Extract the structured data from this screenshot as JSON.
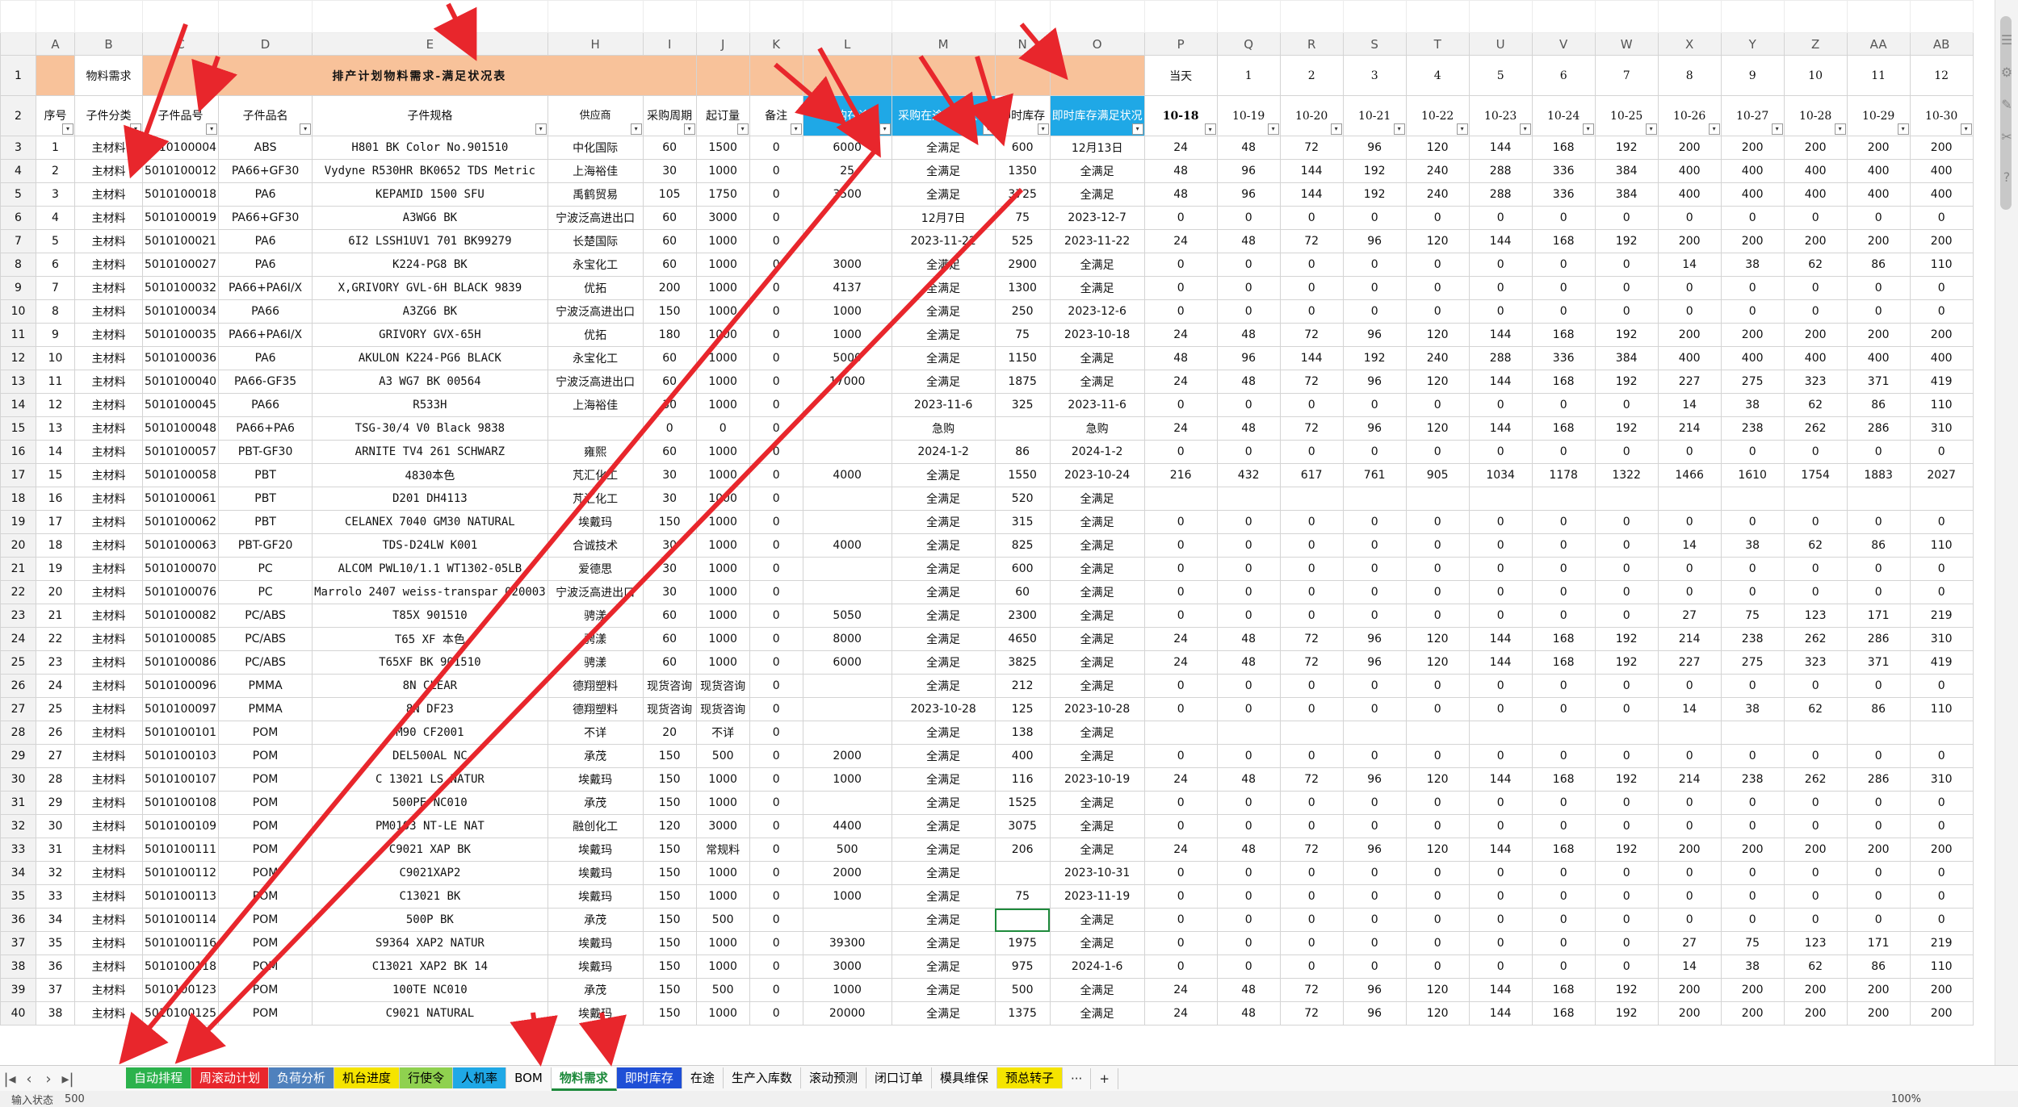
{
  "columns": [
    "A",
    "B",
    "C",
    "D",
    "E",
    "H",
    "I",
    "J",
    "K",
    "L",
    "M",
    "N",
    "O",
    "P",
    "Q",
    "R",
    "S",
    "T",
    "U",
    "V",
    "W",
    "X",
    "Y",
    "Z",
    "AA",
    "AB"
  ],
  "title": "排产计划物料需求-满足状况表",
  "sheet_label": "物料需求",
  "day_labels": [
    "当天",
    "1",
    "2",
    "3",
    "4",
    "5",
    "6",
    "7",
    "8",
    "9",
    "10",
    "11",
    "12"
  ],
  "dates": [
    "10-18",
    "10-19",
    "10-20",
    "10-21",
    "10-22",
    "10-23",
    "10-24",
    "10-25",
    "10-26",
    "10-27",
    "10-28",
    "10-29",
    "10-30"
  ],
  "headers": [
    "序号",
    "子件分类",
    "子件品号",
    "子件品名",
    "子件规格",
    "供应商",
    "采购周期",
    "起订量",
    "备注",
    "采购在途",
    "采购在途满足状况",
    "即时库存",
    "即时库存满足状况"
  ],
  "rows": [
    [
      "1",
      "主材料",
      "5010100004",
      "ABS",
      "H801 BK Color No.901510",
      "中化国际",
      "60",
      "1500",
      "0",
      "6000",
      "全满足",
      "600",
      "12月13日",
      "24",
      "48",
      "72",
      "96",
      "120",
      "144",
      "168",
      "192",
      "200",
      "200",
      "200",
      "200",
      "200"
    ],
    [
      "2",
      "主材料",
      "5010100012",
      "PA66+GF30",
      "Vydyne R530HR BK0652 TDS Metric",
      "上海裕佳",
      "30",
      "1000",
      "0",
      "25",
      "全满足",
      "1350",
      "全满足",
      "48",
      "96",
      "144",
      "192",
      "240",
      "288",
      "336",
      "384",
      "400",
      "400",
      "400",
      "400",
      "400"
    ],
    [
      "3",
      "主材料",
      "5010100018",
      "PA6",
      "KEPAMID 1500 SFU",
      "禹鹤贸易",
      "105",
      "1750",
      "0",
      "3500",
      "全满足",
      "3725",
      "全满足",
      "48",
      "96",
      "144",
      "192",
      "240",
      "288",
      "336",
      "384",
      "400",
      "400",
      "400",
      "400",
      "400"
    ],
    [
      "4",
      "主材料",
      "5010100019",
      "PA66+GF30",
      "A3WG6 BK",
      "宁波泛高进出口",
      "60",
      "3000",
      "0",
      "",
      "12月7日",
      "75",
      "2023-12-7",
      "0",
      "0",
      "0",
      "0",
      "0",
      "0",
      "0",
      "0",
      "0",
      "0",
      "0",
      "0",
      "0"
    ],
    [
      "5",
      "主材料",
      "5010100021",
      "PA6",
      "6I2 LSSH1UV1 701 BK99279",
      "长楚国际",
      "60",
      "1000",
      "0",
      "",
      "2023-11-22",
      "525",
      "2023-11-22",
      "24",
      "48",
      "72",
      "96",
      "120",
      "144",
      "168",
      "192",
      "200",
      "200",
      "200",
      "200",
      "200"
    ],
    [
      "6",
      "主材料",
      "5010100027",
      "PA6",
      "K224-PG8 BK",
      "永宝化工",
      "60",
      "1000",
      "0",
      "3000",
      "全满足",
      "2900",
      "全满足",
      "0",
      "0",
      "0",
      "0",
      "0",
      "0",
      "0",
      "0",
      "14",
      "38",
      "62",
      "86",
      "110"
    ],
    [
      "7",
      "主材料",
      "5010100032",
      "PA66+PA6I/X",
      "X,GRIVORY GVL-6H BLACK 9839",
      "优拓",
      "200",
      "1000",
      "0",
      "4137",
      "全满足",
      "1300",
      "全满足",
      "0",
      "0",
      "0",
      "0",
      "0",
      "0",
      "0",
      "0",
      "0",
      "0",
      "0",
      "0",
      "0"
    ],
    [
      "8",
      "主材料",
      "5010100034",
      "PA66",
      "A3ZG6 BK",
      "宁波泛高进出口",
      "150",
      "1000",
      "0",
      "1000",
      "全满足",
      "250",
      "2023-12-6",
      "0",
      "0",
      "0",
      "0",
      "0",
      "0",
      "0",
      "0",
      "0",
      "0",
      "0",
      "0",
      "0"
    ],
    [
      "9",
      "主材料",
      "5010100035",
      "PA66+PA6I/X",
      "GRIVORY GVX-65H",
      "优拓",
      "180",
      "1000",
      "0",
      "1000",
      "全满足",
      "75",
      "2023-10-18",
      "24",
      "48",
      "72",
      "96",
      "120",
      "144",
      "168",
      "192",
      "200",
      "200",
      "200",
      "200",
      "200"
    ],
    [
      "10",
      "主材料",
      "5010100036",
      "PA6",
      "AKULON K224-PG6 BLACK",
      "永宝化工",
      "60",
      "1000",
      "0",
      "5000",
      "全满足",
      "1150",
      "全满足",
      "48",
      "96",
      "144",
      "192",
      "240",
      "288",
      "336",
      "384",
      "400",
      "400",
      "400",
      "400",
      "400"
    ],
    [
      "11",
      "主材料",
      "5010100040",
      "PA66-GF35",
      "A3 WG7 BK 00564",
      "宁波泛高进出口",
      "60",
      "1000",
      "0",
      "17000",
      "全满足",
      "1875",
      "全满足",
      "24",
      "48",
      "72",
      "96",
      "120",
      "144",
      "168",
      "192",
      "227",
      "275",
      "323",
      "371",
      "419"
    ],
    [
      "12",
      "主材料",
      "5010100045",
      "PA66",
      "R533H",
      "上海裕佳",
      "30",
      "1000",
      "0",
      "",
      "2023-11-6",
      "325",
      "2023-11-6",
      "0",
      "0",
      "0",
      "0",
      "0",
      "0",
      "0",
      "0",
      "14",
      "38",
      "62",
      "86",
      "110"
    ],
    [
      "13",
      "主材料",
      "5010100048",
      "PA66+PA6",
      "TSG-30/4 V0 Black 9838",
      "",
      "0",
      "0",
      "0",
      "",
      "急购",
      "",
      "急购",
      "24",
      "48",
      "72",
      "96",
      "120",
      "144",
      "168",
      "192",
      "214",
      "238",
      "262",
      "286",
      "310"
    ],
    [
      "14",
      "主材料",
      "5010100057",
      "PBT-GF30",
      "ARNITE TV4 261  SCHWARZ",
      "雍熙",
      "60",
      "1000",
      "0",
      "",
      "2024-1-2",
      "86",
      "2024-1-2",
      "0",
      "0",
      "0",
      "0",
      "0",
      "0",
      "0",
      "0",
      "0",
      "0",
      "0",
      "0",
      "0"
    ],
    [
      "15",
      "主材料",
      "5010100058",
      "PBT",
      "4830本色",
      "芃汇化工",
      "30",
      "1000",
      "0",
      "4000",
      "全满足",
      "1550",
      "2023-10-24",
      "216",
      "432",
      "617",
      "761",
      "905",
      "1034",
      "1178",
      "1322",
      "1466",
      "1610",
      "1754",
      "1883",
      "2027"
    ],
    [
      "16",
      "主材料",
      "5010100061",
      "PBT",
      "D201 DH4113",
      "芃汇化工",
      "30",
      "1000",
      "0",
      "",
      "全满足",
      "520",
      "全满足",
      "",
      "",
      "",
      "",
      "",
      "",
      "",
      "",
      "",
      "",
      "",
      "",
      ""
    ],
    [
      "17",
      "主材料",
      "5010100062",
      "PBT",
      "CELANEX 7040 GM30 NATURAL",
      "埃戴玛",
      "150",
      "1000",
      "0",
      "",
      "全满足",
      "315",
      "全满足",
      "0",
      "0",
      "0",
      "0",
      "0",
      "0",
      "0",
      "0",
      "0",
      "0",
      "0",
      "0",
      "0"
    ],
    [
      "18",
      "主材料",
      "5010100063",
      "PBT-GF20",
      "TDS-D24LW  K001",
      "合诚技术",
      "30",
      "1000",
      "0",
      "4000",
      "全满足",
      "825",
      "全满足",
      "0",
      "0",
      "0",
      "0",
      "0",
      "0",
      "0",
      "0",
      "14",
      "38",
      "62",
      "86",
      "110"
    ],
    [
      "19",
      "主材料",
      "5010100070",
      "PC",
      "ALCOM  PWL10/1.1 WT1302-05LB",
      "爱德思",
      "30",
      "1000",
      "0",
      "",
      "全满足",
      "600",
      "全满足",
      "0",
      "0",
      "0",
      "0",
      "0",
      "0",
      "0",
      "0",
      "0",
      "0",
      "0",
      "0",
      "0"
    ],
    [
      "20",
      "主材料",
      "5010100076",
      "PC",
      "Marrolo 2407 weiss-transpar 020003",
      "宁波泛高进出口",
      "30",
      "1000",
      "0",
      "",
      "全满足",
      "60",
      "全满足",
      "0",
      "0",
      "0",
      "0",
      "0",
      "0",
      "0",
      "0",
      "0",
      "0",
      "0",
      "0",
      "0"
    ],
    [
      "21",
      "主材料",
      "5010100082",
      "PC/ABS",
      "T85X 901510",
      "骋漾",
      "60",
      "1000",
      "0",
      "5050",
      "全满足",
      "2300",
      "全满足",
      "0",
      "0",
      "0",
      "0",
      "0",
      "0",
      "0",
      "0",
      "27",
      "75",
      "123",
      "171",
      "219"
    ],
    [
      "22",
      "主材料",
      "5010100085",
      "PC/ABS",
      "T65 XF 本色",
      "骋漾",
      "60",
      "1000",
      "0",
      "8000",
      "全满足",
      "4650",
      "全满足",
      "24",
      "48",
      "72",
      "96",
      "120",
      "144",
      "168",
      "192",
      "214",
      "238",
      "262",
      "286",
      "310"
    ],
    [
      "23",
      "主材料",
      "5010100086",
      "PC/ABS",
      "T65XF BK 901510",
      "骋漾",
      "60",
      "1000",
      "0",
      "6000",
      "全满足",
      "3825",
      "全满足",
      "24",
      "48",
      "72",
      "96",
      "120",
      "144",
      "168",
      "192",
      "227",
      "275",
      "323",
      "371",
      "419"
    ],
    [
      "24",
      "主材料",
      "5010100096",
      "PMMA",
      "8N CLEAR",
      "德翔塑料",
      "现货咨询",
      "现货咨询",
      "0",
      "",
      "全满足",
      "212",
      "全满足",
      "0",
      "0",
      "0",
      "0",
      "0",
      "0",
      "0",
      "0",
      "0",
      "0",
      "0",
      "0",
      "0"
    ],
    [
      "25",
      "主材料",
      "5010100097",
      "PMMA",
      "8N  DF23",
      "德翔塑料",
      "现货咨询",
      "现货咨询",
      "0",
      "",
      "2023-10-28",
      "125",
      "2023-10-28",
      "0",
      "0",
      "0",
      "0",
      "0",
      "0",
      "0",
      "0",
      "14",
      "38",
      "62",
      "86",
      "110"
    ],
    [
      "26",
      "主材料",
      "5010100101",
      "POM",
      "M90 CF2001",
      "不详",
      "20",
      "不详",
      "0",
      "",
      "全满足",
      "138",
      "全满足",
      "",
      "",
      "",
      "",
      "",
      "",
      "",
      "",
      "",
      "",
      "",
      "",
      ""
    ],
    [
      "27",
      "主材料",
      "5010100103",
      "POM",
      "DEL500AL NC",
      "承茂",
      "150",
      "500",
      "0",
      "2000",
      "全满足",
      "400",
      "全满足",
      "0",
      "0",
      "0",
      "0",
      "0",
      "0",
      "0",
      "0",
      "0",
      "0",
      "0",
      "0",
      "0"
    ],
    [
      "28",
      "主材料",
      "5010100107",
      "POM",
      "C 13021 LS NATUR",
      "埃戴玛",
      "150",
      "1000",
      "0",
      "1000",
      "全满足",
      "116",
      "2023-10-19",
      "24",
      "48",
      "72",
      "96",
      "120",
      "144",
      "168",
      "192",
      "214",
      "238",
      "262",
      "286",
      "310"
    ],
    [
      "29",
      "主材料",
      "5010100108",
      "POM",
      "500PE NC010",
      "承茂",
      "150",
      "1000",
      "0",
      "",
      "全满足",
      "1525",
      "全满足",
      "0",
      "0",
      "0",
      "0",
      "0",
      "0",
      "0",
      "0",
      "0",
      "0",
      "0",
      "0",
      "0"
    ],
    [
      "30",
      "主材料",
      "5010100109",
      "POM",
      "PM0103 NT-LE NAT",
      "融创化工",
      "120",
      "3000",
      "0",
      "4400",
      "全满足",
      "3075",
      "全满足",
      "0",
      "0",
      "0",
      "0",
      "0",
      "0",
      "0",
      "0",
      "0",
      "0",
      "0",
      "0",
      "0"
    ],
    [
      "31",
      "主材料",
      "5010100111",
      "POM",
      "C9021 XAP BK",
      "埃戴玛",
      "150",
      "常规料",
      "0",
      "500",
      "全满足",
      "206",
      "全满足",
      "24",
      "48",
      "72",
      "96",
      "120",
      "144",
      "168",
      "192",
      "200",
      "200",
      "200",
      "200",
      "200"
    ],
    [
      "32",
      "主材料",
      "5010100112",
      "POM",
      "C9021XAP2",
      "埃戴玛",
      "150",
      "1000",
      "0",
      "2000",
      "全满足",
      "",
      "2023-10-31",
      "0",
      "0",
      "0",
      "0",
      "0",
      "0",
      "0",
      "0",
      "0",
      "0",
      "0",
      "0",
      "0"
    ],
    [
      "33",
      "主材料",
      "5010100113",
      "POM",
      "C13021 BK",
      "埃戴玛",
      "150",
      "1000",
      "0",
      "1000",
      "全满足",
      "75",
      "2023-11-19",
      "0",
      "0",
      "0",
      "0",
      "0",
      "0",
      "0",
      "0",
      "0",
      "0",
      "0",
      "0",
      "0"
    ],
    [
      "34",
      "主材料",
      "5010100114",
      "POM",
      "500P BK",
      "承茂",
      "150",
      "500",
      "0",
      "",
      "全满足",
      "",
      "全满足",
      "0",
      "0",
      "0",
      "0",
      "0",
      "0",
      "0",
      "0",
      "0",
      "0",
      "0",
      "0",
      "0"
    ],
    [
      "35",
      "主材料",
      "5010100116",
      "POM",
      "S9364 XAP2 NATUR",
      "埃戴玛",
      "150",
      "1000",
      "0",
      "39300",
      "全满足",
      "1975",
      "全满足",
      "0",
      "0",
      "0",
      "0",
      "0",
      "0",
      "0",
      "0",
      "27",
      "75",
      "123",
      "171",
      "219"
    ],
    [
      "36",
      "主材料",
      "5010100118",
      "POM",
      "C13021 XAP2 BK 14",
      "埃戴玛",
      "150",
      "1000",
      "0",
      "3000",
      "全满足",
      "975",
      "2024-1-6",
      "0",
      "0",
      "0",
      "0",
      "0",
      "0",
      "0",
      "0",
      "14",
      "38",
      "62",
      "86",
      "110"
    ],
    [
      "37",
      "主材料",
      "5010100123",
      "POM",
      "100TE NC010",
      "承茂",
      "150",
      "500",
      "0",
      "1000",
      "全满足",
      "500",
      "全满足",
      "24",
      "48",
      "72",
      "96",
      "120",
      "144",
      "168",
      "192",
      "200",
      "200",
      "200",
      "200",
      "200"
    ],
    [
      "38",
      "主材料",
      "5010100125",
      "POM",
      "C9021 NATURAL",
      "埃戴玛",
      "150",
      "1000",
      "0",
      "20000",
      "全满足",
      "1375",
      "全满足",
      "24",
      "48",
      "72",
      "96",
      "120",
      "144",
      "168",
      "192",
      "200",
      "200",
      "200",
      "200",
      "200"
    ]
  ],
  "tabs": [
    {
      "label": "自动排程",
      "bg": "#2bb24c",
      "color": "#ffffff"
    },
    {
      "label": "周滚动计划",
      "bg": "#e8262c",
      "color": "#ffffff"
    },
    {
      "label": "负荷分析",
      "bg": "#4f81bd",
      "color": "#ffffff"
    },
    {
      "label": "机台进度",
      "bg": "#f5e400",
      "color": "#000000"
    },
    {
      "label": "行使令",
      "bg": "#8fd14f",
      "color": "#000000"
    },
    {
      "label": "人机率",
      "bg": "#1fa8e6",
      "color": "#000000"
    },
    {
      "label": "BOM",
      "bg": "#f7f7f7",
      "color": "#000000"
    },
    {
      "label": "物料需求",
      "bg": "#ffffff",
      "color": "#1e8a3c"
    },
    {
      "label": "即时库存",
      "bg": "#1f4fd6",
      "color": "#ffffff"
    },
    {
      "label": "在途",
      "bg": "#f7f7f7",
      "color": "#000000"
    },
    {
      "label": "生产入库数",
      "bg": "#f7f7f7",
      "color": "#000000"
    },
    {
      "label": "滚动预测",
      "bg": "#f7f7f7",
      "color": "#000000"
    },
    {
      "label": "闭口订单",
      "bg": "#f7f7f7",
      "color": "#000000"
    },
    {
      "label": "模具维保",
      "bg": "#f7f7f7",
      "color": "#000000"
    },
    {
      "label": "预总转子",
      "bg": "#f5e400",
      "color": "#000000"
    }
  ],
  "status": {
    "mode": "输入状态",
    "value": "500",
    "zoom": "100%"
  },
  "more_tabs": "···",
  "add_tab": "+"
}
